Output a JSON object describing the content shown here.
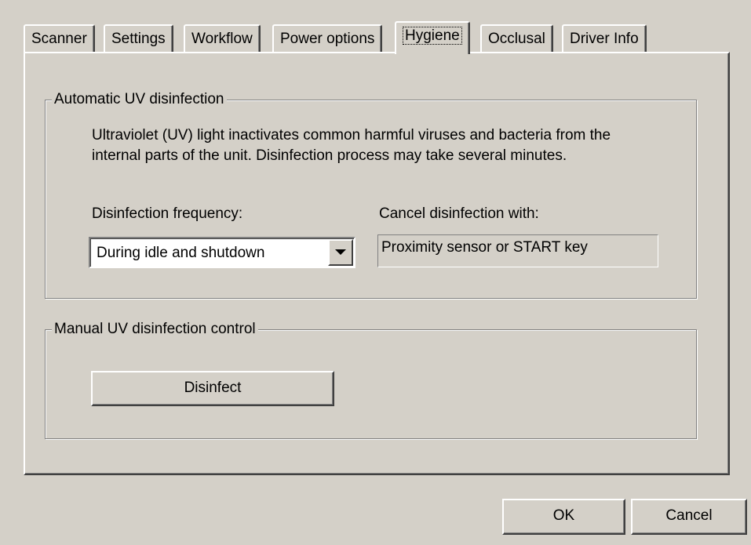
{
  "tabs": [
    {
      "label": "Scanner",
      "active": false
    },
    {
      "label": "Settings",
      "active": false
    },
    {
      "label": "Workflow",
      "active": false
    },
    {
      "label": "Power options",
      "active": false
    },
    {
      "label": "Hygiene",
      "active": true
    },
    {
      "label": "Occlusal",
      "active": false
    },
    {
      "label": "Driver Info",
      "active": false
    }
  ],
  "automatic_group": {
    "legend": "Automatic UV disinfection",
    "description_line1": "Ultraviolet (UV) light inactivates common harmful viruses and bacteria from the",
    "description_line2": "internal parts of the unit. Disinfection process may take several minutes.",
    "frequency_label": "Disinfection frequency:",
    "frequency_value": "During idle and shutdown",
    "cancel_label": "Cancel disinfection with:",
    "cancel_value": "Proximity sensor or START key"
  },
  "manual_group": {
    "legend": "Manual UV disinfection control",
    "disinfect_button": "Disinfect"
  },
  "footer": {
    "ok_label": "OK",
    "cancel_label": "Cancel"
  },
  "colors": {
    "face": "#d4d0c8",
    "highlight": "#ffffff",
    "shadow": "#808080",
    "dark_shadow": "#404040"
  }
}
